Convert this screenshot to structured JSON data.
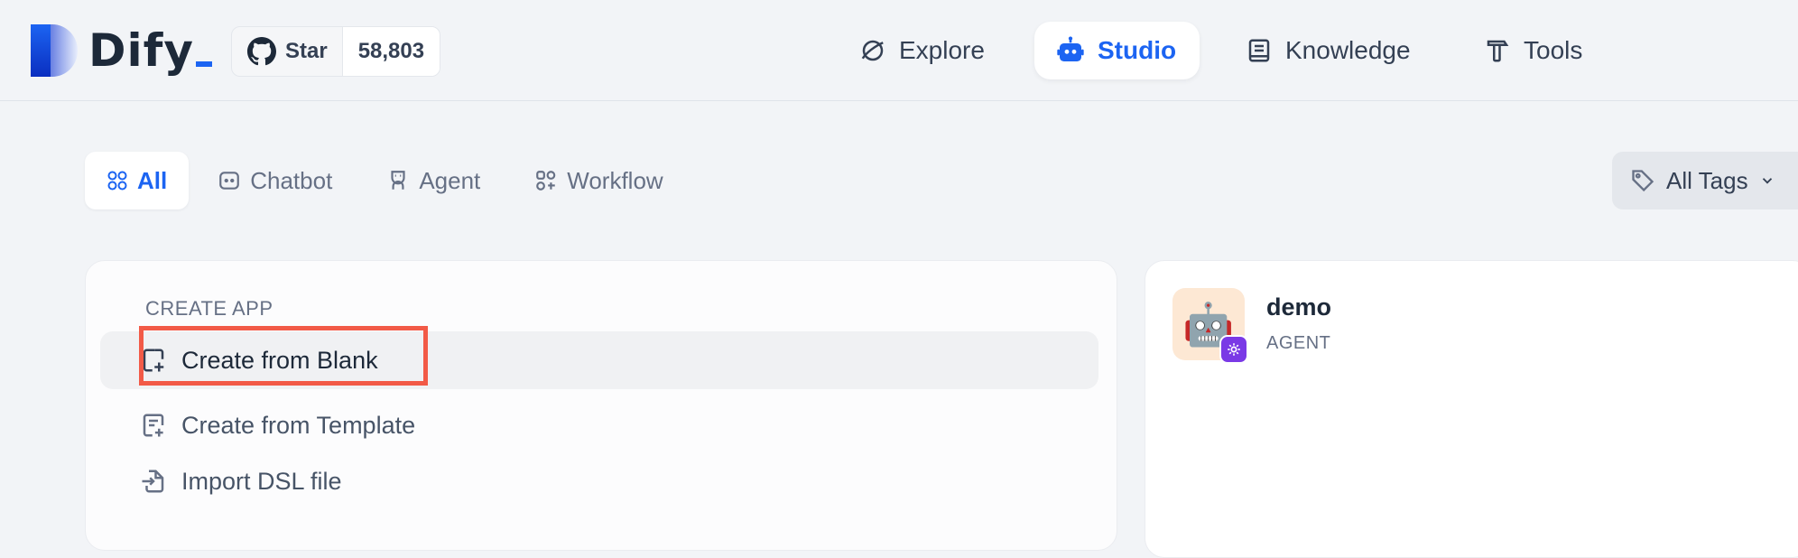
{
  "header": {
    "logo_text": "Dify",
    "github": {
      "star_label": "Star",
      "star_count": "58,803"
    },
    "nav": [
      {
        "label": "Explore",
        "icon": "explore-icon",
        "active": false
      },
      {
        "label": "Studio",
        "icon": "robot-icon",
        "active": true
      },
      {
        "label": "Knowledge",
        "icon": "book-icon",
        "active": false
      },
      {
        "label": "Tools",
        "icon": "hammer-icon",
        "active": false
      }
    ]
  },
  "filters": {
    "tabs": [
      {
        "label": "All",
        "icon": "grid-icon",
        "active": true
      },
      {
        "label": "Chatbot",
        "icon": "chat-bubble-icon",
        "active": false
      },
      {
        "label": "Agent",
        "icon": "agent-icon",
        "active": false
      },
      {
        "label": "Workflow",
        "icon": "workflow-icon",
        "active": false
      }
    ],
    "tags_label": "All Tags"
  },
  "create_app": {
    "title": "CREATE APP",
    "options": [
      {
        "label": "Create from Blank",
        "icon": "new-file-icon",
        "hovered": true
      },
      {
        "label": "Create from Template",
        "icon": "template-icon",
        "hovered": false
      },
      {
        "label": "Import DSL file",
        "icon": "import-file-icon",
        "hovered": false
      }
    ]
  },
  "apps": [
    {
      "name": "demo",
      "type": "AGENT",
      "emoji": "🤖",
      "badge_icon": "agent-badge-icon"
    }
  ],
  "colors": {
    "accent": "#1c64f2",
    "highlight_border": "#f25a47",
    "app_icon_bg": "#fde8d4",
    "agent_badge": "#7a39e6"
  }
}
